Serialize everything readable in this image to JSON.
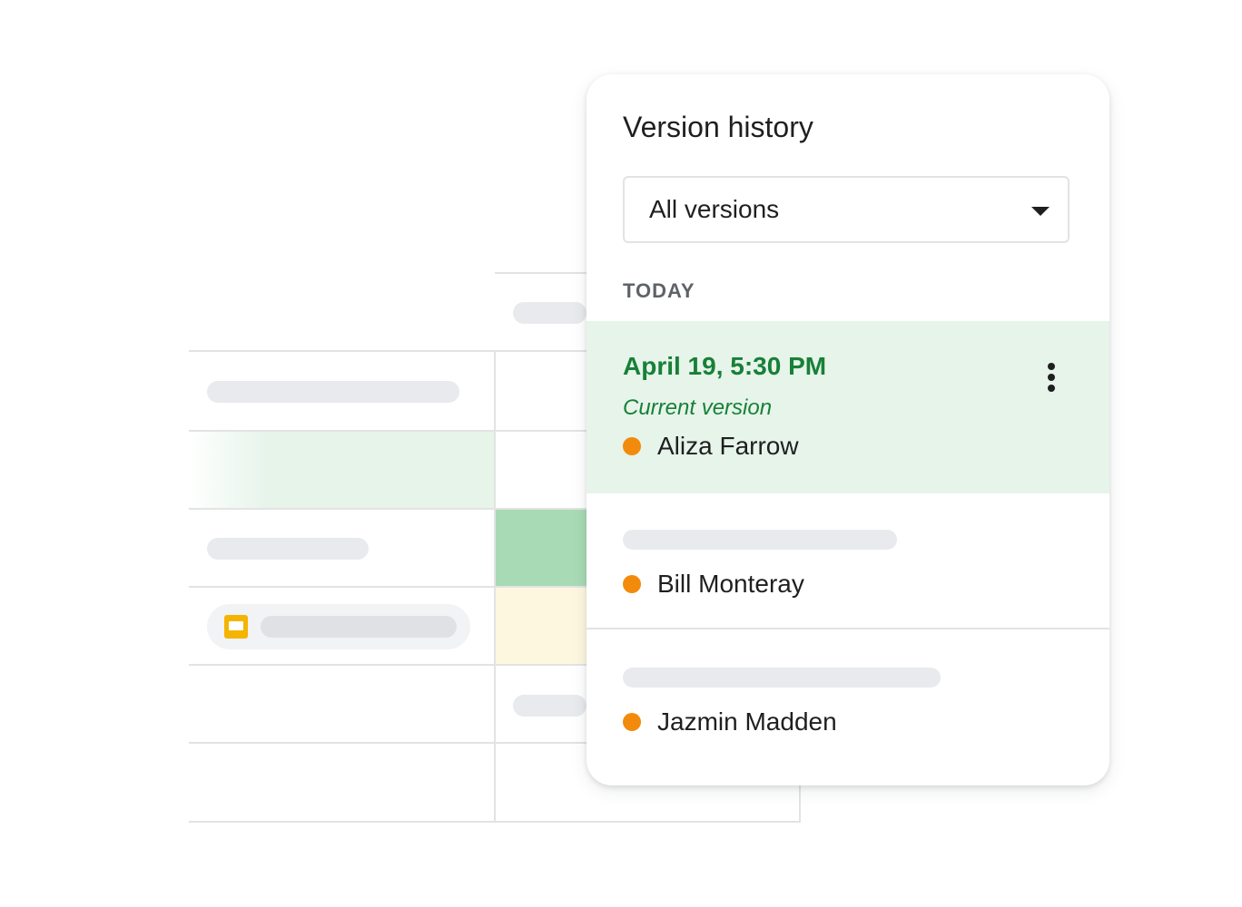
{
  "panel": {
    "title": "Version history",
    "filter": {
      "selected": "All versions",
      "arrow_icon": "caret-down-icon"
    },
    "section_label": "TODAY",
    "versions": [
      {
        "time": "April 19, 5:30 PM",
        "status": "Current version",
        "author": "Aliza Farrow",
        "author_color": "#f28b0c",
        "menu_icon": "more-vert-icon",
        "highlight_color": "#e6f4ea"
      },
      {
        "author": "Bill Monteray",
        "author_color": "#f28b0c"
      },
      {
        "author": "Jazmin Madden",
        "author_color": "#f28b0c"
      }
    ]
  },
  "sheet": {
    "attachment_icon": "slides-icon",
    "colors": {
      "highlight_row": "#e6f4ea",
      "green_cell": "#a8dab5",
      "yellow_cell": "#fef7e0",
      "placeholder": "#e8eaed"
    }
  },
  "colors": {
    "accent_green": "#188038",
    "author_dot": "#f28b0c",
    "text_primary": "#1f1f1f",
    "text_secondary": "#5f6368"
  }
}
